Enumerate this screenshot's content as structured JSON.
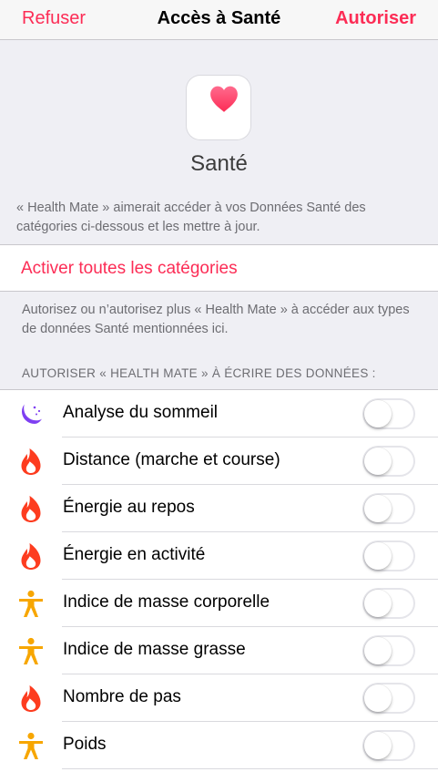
{
  "navbar": {
    "left_label": "Refuser",
    "title": "Accès à Santé",
    "right_label": "Autoriser"
  },
  "app": {
    "name": "Santé",
    "icon": "heart-icon"
  },
  "intro": "« Health Mate » aimerait accéder à vos Données Santé des catégories ci-dessous et les mettre à jour.",
  "enable_all_label": "Activer toutes les catégories",
  "hint": "Autorisez ou n’autorisez plus « Health Mate » à accéder aux types de données Santé mentionnées ici.",
  "section_header": "AUTORISER « HEALTH MATE » À ÉCRIRE DES DONNÉES :",
  "colors": {
    "accent": "#fc2c55",
    "sleep": "#7e3ff2",
    "activity": "#fd3c1f",
    "body": "#f7a600"
  },
  "categories": [
    {
      "label": "Analyse du sommeil",
      "icon": "moon-icon",
      "enabled": false
    },
    {
      "label": "Distance (marche et course)",
      "icon": "flame-icon",
      "enabled": false
    },
    {
      "label": "Énergie au repos",
      "icon": "flame-icon",
      "enabled": false
    },
    {
      "label": "Énergie en activité",
      "icon": "flame-icon",
      "enabled": false
    },
    {
      "label": "Indice de masse corporelle",
      "icon": "person-icon",
      "enabled": false
    },
    {
      "label": "Indice de masse grasse",
      "icon": "person-icon",
      "enabled": false
    },
    {
      "label": "Nombre de pas",
      "icon": "flame-icon",
      "enabled": false
    },
    {
      "label": "Poids",
      "icon": "person-icon",
      "enabled": false
    }
  ]
}
